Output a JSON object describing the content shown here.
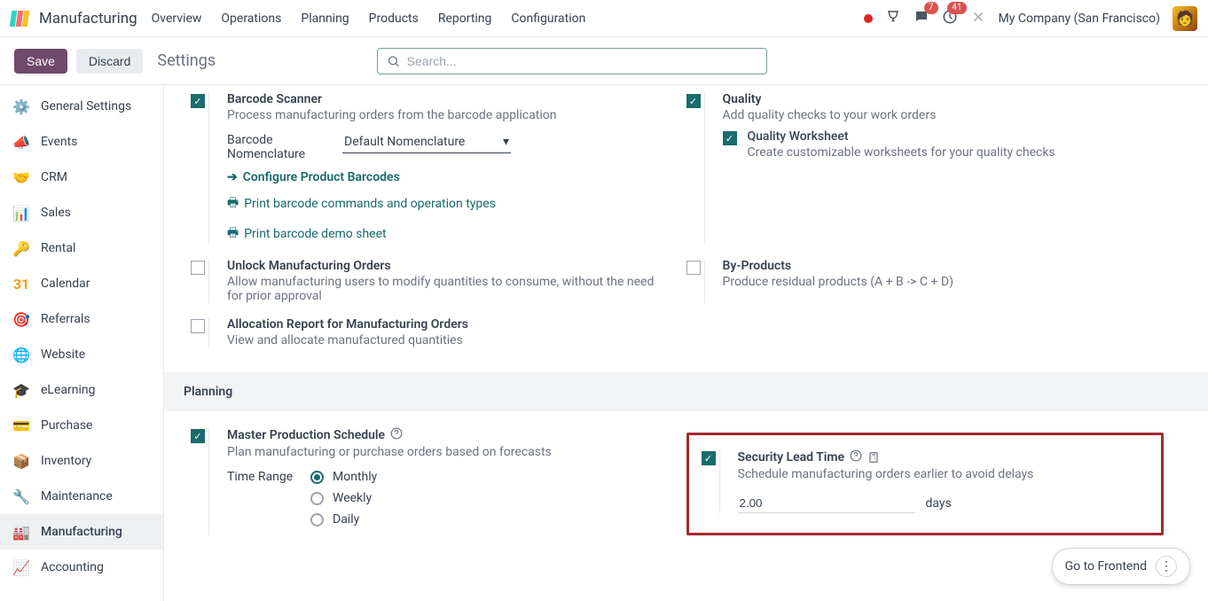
{
  "brand": "Manufacturing",
  "mainnav": [
    "Overview",
    "Operations",
    "Planning",
    "Products",
    "Reporting",
    "Configuration"
  ],
  "tray": {
    "msg_count": "7",
    "bell_count": "41"
  },
  "company": "My Company (San Francisco)",
  "controls": {
    "save": "Save",
    "discard": "Discard",
    "title": "Settings",
    "search_placeholder": "Search..."
  },
  "sidebar": [
    {
      "label": "General Settings",
      "icon_bg": "#8b5cf6"
    },
    {
      "label": "Events",
      "icon_bg": "#f59e0b"
    },
    {
      "label": "CRM",
      "icon_bg": "#14b8a6"
    },
    {
      "label": "Sales",
      "icon_bg": "#ef4444"
    },
    {
      "label": "Rental",
      "icon_bg": "#3b82f6"
    },
    {
      "label": "Calendar",
      "icon_bg": "#f59e0b"
    },
    {
      "label": "Referrals",
      "icon_bg": "#ec4899"
    },
    {
      "label": "Website",
      "icon_bg": "#06b6d4"
    },
    {
      "label": "eLearning",
      "icon_bg": "#1e293b"
    },
    {
      "label": "Purchase",
      "icon_bg": "#6366f1"
    },
    {
      "label": "Inventory",
      "icon_bg": "#f97316"
    },
    {
      "label": "Maintenance",
      "icon_bg": "#10b981"
    },
    {
      "label": "Manufacturing",
      "icon_bg": "#8b5cf6"
    },
    {
      "label": "Accounting",
      "icon_bg": "#6b7280"
    }
  ],
  "settings": {
    "barcode": {
      "title": "Barcode Scanner",
      "desc": "Process manufacturing orders from the barcode application",
      "nomen_label": "Barcode Nomenclature",
      "nomen_value": "Default Nomenclature",
      "link1": "Configure Product Barcodes",
      "link2": "Print barcode commands and operation types",
      "link3": "Print barcode demo sheet"
    },
    "quality": {
      "title": "Quality",
      "desc": "Add quality checks to your work orders",
      "ws_title": "Quality Worksheet",
      "ws_desc": "Create customizable worksheets for your quality checks"
    },
    "unlock": {
      "title": "Unlock Manufacturing Orders",
      "desc": "Allow manufacturing users to modify quantities to consume, without the need for prior approval"
    },
    "byprod": {
      "title": "By-Products",
      "desc": "Produce residual products (A + B -> C + D)"
    },
    "alloc": {
      "title": "Allocation Report for Manufacturing Orders",
      "desc": "View and allocate manufactured quantities"
    },
    "section_planning": "Planning",
    "mps": {
      "title": "Master Production Schedule",
      "desc": "Plan manufacturing or purchase orders based on forecasts",
      "range_label": "Time Range",
      "opts": [
        "Monthly",
        "Weekly",
        "Daily"
      ]
    },
    "sec_lead": {
      "title": "Security Lead Time",
      "desc": "Schedule manufacturing orders earlier to avoid delays",
      "value": "2.00",
      "unit": "days"
    }
  },
  "frontend_btn": "Go to Frontend"
}
